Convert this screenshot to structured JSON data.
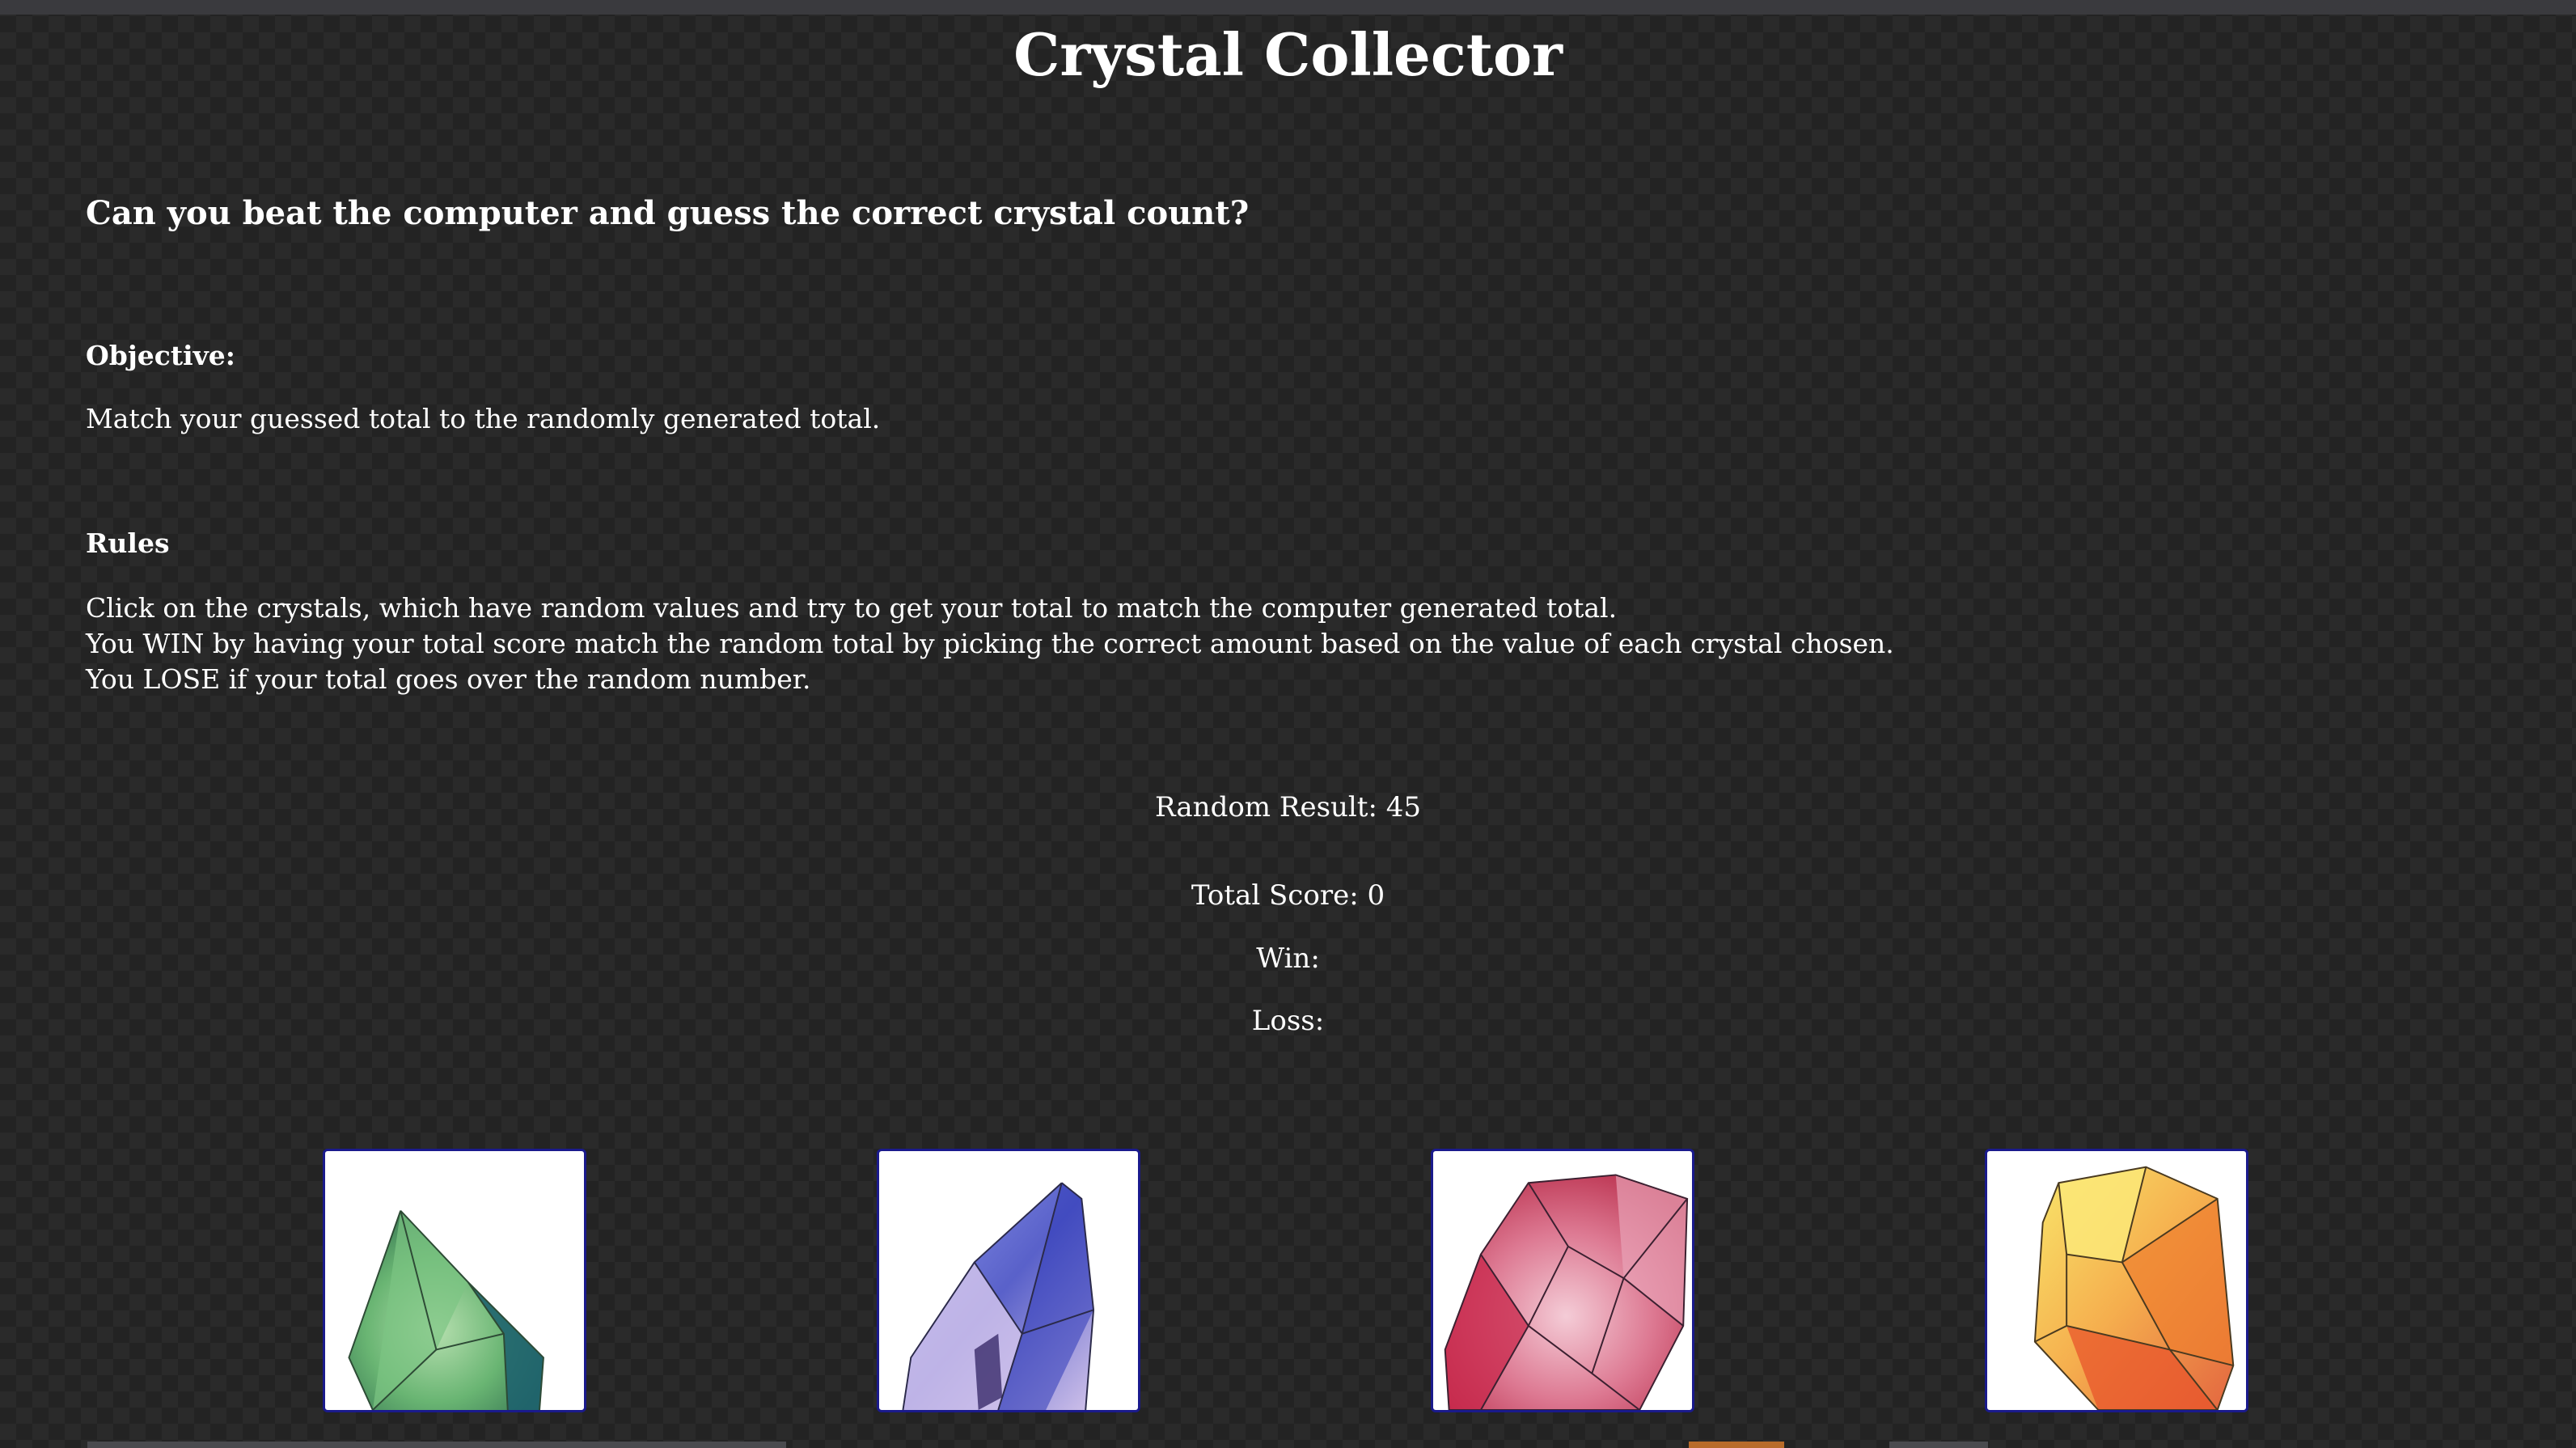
{
  "page": {
    "title": "Crystal Collector",
    "subtitle": "Can you beat the computer and guess the correct crystal count?"
  },
  "objective": {
    "heading": "Objective:",
    "text": "Match your guessed total to the randomly generated total."
  },
  "rules": {
    "heading": "Rules",
    "lines": [
      "Click on the crystals, which have random values and try to get your total to match the computer generated total.",
      "You WIN by having your total score match the random total by picking the correct amount based on the value of each crystal chosen.",
      "You LOSE if your total goes over the random number."
    ]
  },
  "stats": {
    "random_result": "Random Result: 45",
    "total_score": "Total Score: 0",
    "win": "Win:",
    "loss": "Loss:"
  },
  "crystals": [
    {
      "name": "green-crystal",
      "color": "#3f9a4a"
    },
    {
      "name": "blue-crystal",
      "color": "#4a52c8"
    },
    {
      "name": "pink-crystal",
      "color": "#d0566e"
    },
    {
      "name": "yellow-crystal",
      "color": "#f0b32a"
    }
  ],
  "colors": {
    "background": "#2a2a2a",
    "text": "#ffffff",
    "crystal_border": "#1a1a8c"
  }
}
